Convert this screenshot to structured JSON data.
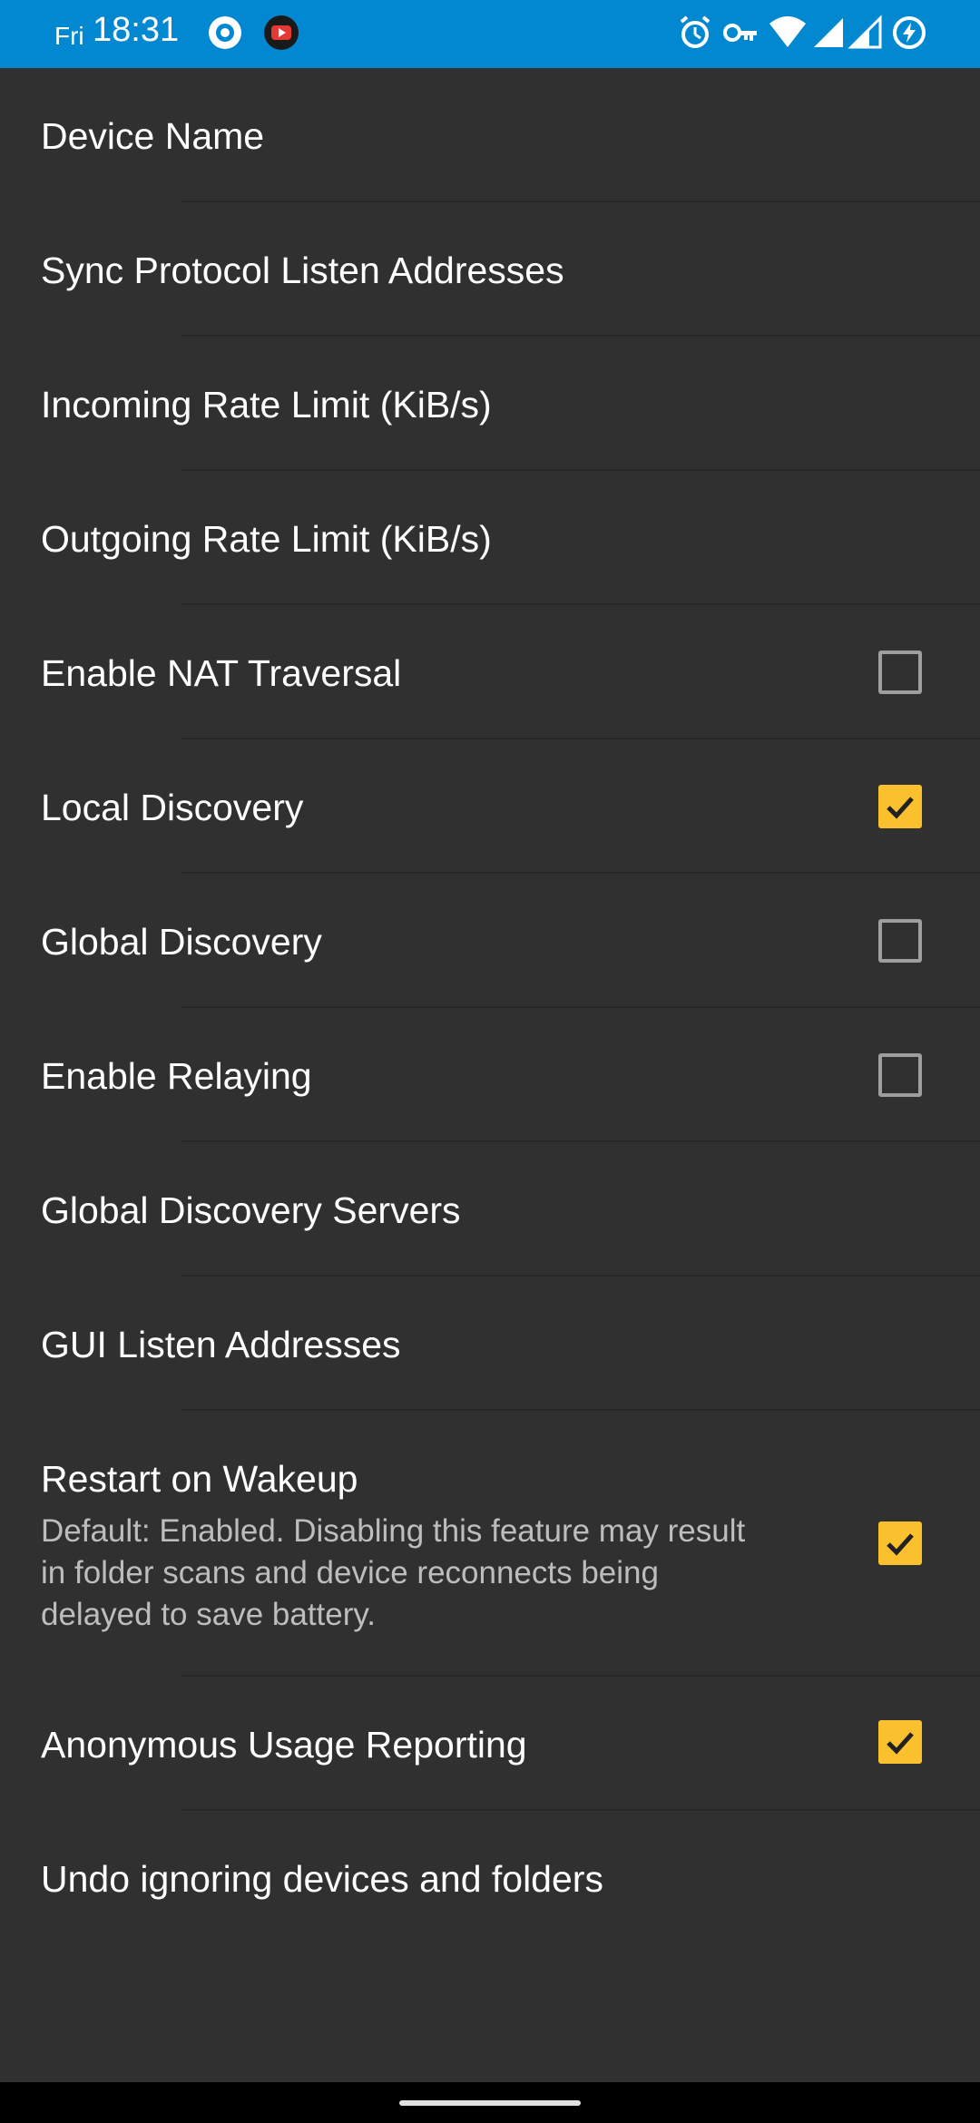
{
  "status_bar": {
    "day": "Fri",
    "time": "18:31",
    "left_icons": [
      "settings-gear-icon",
      "youtube-icon"
    ],
    "right_icons": [
      "alarm-icon",
      "vpn-key-icon",
      "wifi-icon",
      "signal-icon",
      "signal-icon",
      "battery-saver-icon"
    ],
    "background": "#0288d1"
  },
  "settings": {
    "items": [
      {
        "title": "Device Name"
      },
      {
        "title": "Sync Protocol Listen Addresses"
      },
      {
        "title": "Incoming Rate Limit (KiB/s)"
      },
      {
        "title": "Outgoing Rate Limit (KiB/s)"
      },
      {
        "title": "Enable NAT Traversal",
        "checked": false
      },
      {
        "title": "Local Discovery",
        "checked": true
      },
      {
        "title": "Global Discovery",
        "checked": false
      },
      {
        "title": "Enable Relaying",
        "checked": false
      },
      {
        "title": "Global Discovery Servers"
      },
      {
        "title": "GUI Listen Addresses"
      },
      {
        "title": "Restart on Wakeup",
        "summary": "Default: Enabled. Disabling this feature may result in folder scans and device reconnects being delayed to save battery.",
        "checked": true
      },
      {
        "title": "Anonymous Usage Reporting",
        "checked": true
      },
      {
        "title": "Undo ignoring devices and folders"
      }
    ]
  },
  "colors": {
    "background": "#303030",
    "checkbox_checked": "#fbc02d",
    "checkbox_unchecked_border": "#9e9e9e"
  }
}
